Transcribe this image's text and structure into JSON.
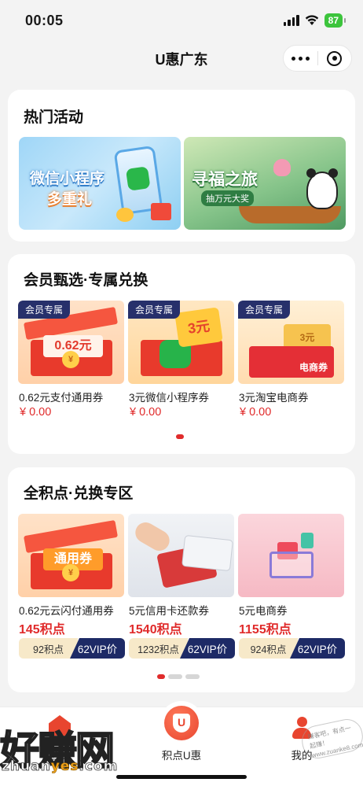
{
  "status_bar": {
    "time": "00:05",
    "battery": "87"
  },
  "nav": {
    "title": "U惠广东"
  },
  "hot": {
    "title": "热门活动",
    "banners": [
      {
        "line1": "微信小程序",
        "line2": "多重礼"
      },
      {
        "line1": "寻福之旅",
        "line2": "抽万元大奖"
      }
    ]
  },
  "member": {
    "title": "会员甄选·专属兑换",
    "tag": "会员专属",
    "items": [
      {
        "name": "0.62元支付通用券",
        "price": "¥ 0.00",
        "art": "0.62元"
      },
      {
        "name": "3元微信小程序券",
        "price": "¥ 0.00",
        "art": "3元"
      },
      {
        "name": "3元淘宝电商券",
        "price": "¥ 0.00",
        "art": "电商券"
      }
    ]
  },
  "points": {
    "title": "全积点·兑换专区",
    "items": [
      {
        "name": "0.62元云闪付通用券",
        "points": "145积点",
        "vip_points": "92积点",
        "vip_label": "62VIP价",
        "art": "通用券"
      },
      {
        "name": "5元信用卡还款券",
        "points": "1540积点",
        "vip_points": "1232积点",
        "vip_label": "62VIP价"
      },
      {
        "name": "5元电商券",
        "points": "1155积点",
        "vip_points": "924积点",
        "vip_label": "62VIP价"
      }
    ]
  },
  "tabs": [
    {
      "label": "首页"
    },
    {
      "label": "积点U惠"
    },
    {
      "label": "我的"
    }
  ],
  "watermark": {
    "logo": "好赚网",
    "url_a": "zhuan",
    "url_b": "yes",
    "url_c": ".com",
    "stamp": "赚客吧，有点一起赚！www.zuanke8.com"
  },
  "colors": {
    "accent": "#e02b2b",
    "vip_dark": "#1d2a66",
    "member_tag": "#27306b",
    "background": "#f3f3f3"
  },
  "icons": [
    "signal-icon",
    "wifi-icon",
    "battery-icon",
    "more-icon",
    "close-icon",
    "home-icon",
    "uhui-icon",
    "user-icon"
  ]
}
